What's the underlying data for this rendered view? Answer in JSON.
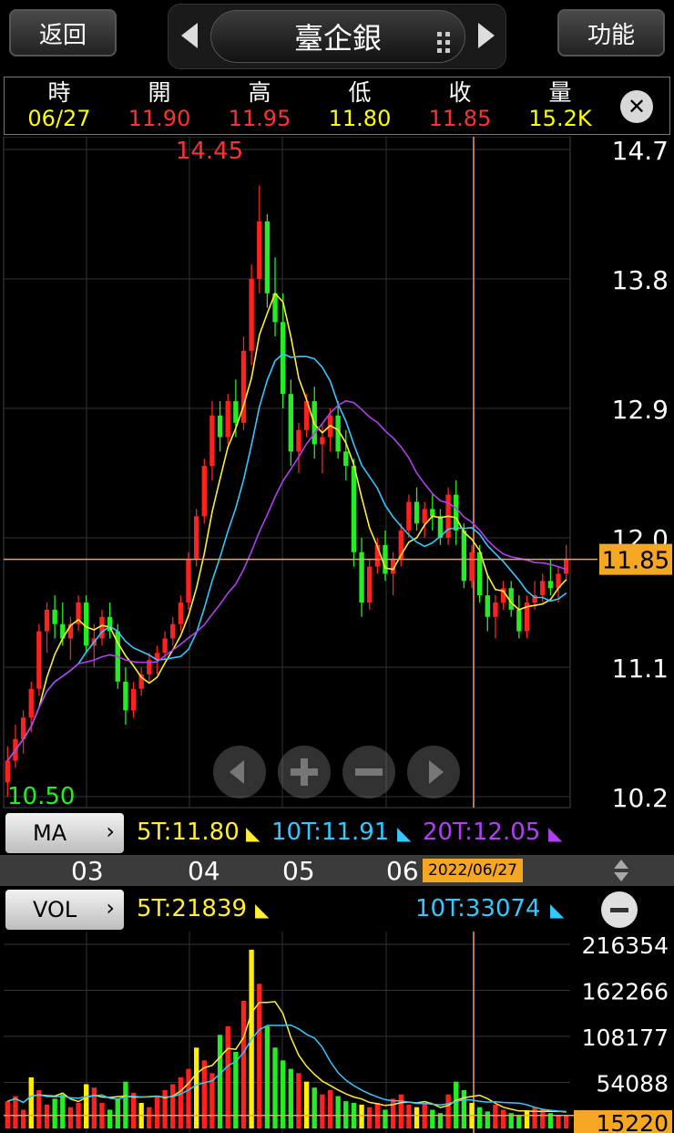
{
  "header": {
    "back_label": "返回",
    "title": "臺企銀",
    "function_label": "功能"
  },
  "quote": {
    "labels": [
      "時",
      "開",
      "高",
      "低",
      "收",
      "量"
    ],
    "values": [
      "06/27",
      "11.90",
      "11.95",
      "11.80",
      "11.85",
      "15.2K"
    ],
    "colors": [
      "#ffff00",
      "#ff3030",
      "#ff3030",
      "#ffff00",
      "#ff3030",
      "#ffff00"
    ]
  },
  "price_chart": {
    "max_label": "14.45",
    "min_label": "10.50",
    "y_ticks": [
      "14.7",
      "13.8",
      "12.9",
      "12.0",
      "11.1",
      "10.2"
    ],
    "current_price": "11.85",
    "current_price_value": 11.85,
    "ylim": [
      10.2,
      14.7
    ]
  },
  "ma_legend": {
    "button_label": "MA",
    "ma5": "5T:11.80",
    "ma10": "10T:11.91",
    "ma20": "20T:12.05",
    "colors": {
      "ma5": "#ffee33",
      "ma10": "#33c8ff",
      "ma20": "#b040f0"
    }
  },
  "timeline": {
    "months": [
      "03",
      "04",
      "05",
      "06"
    ],
    "selected_date": "2022/06/27"
  },
  "volume": {
    "button_label": "VOL",
    "ma5": "5T:21839",
    "ma10": "10T:33074",
    "y_ticks": [
      "216354",
      "162266",
      "108177",
      "54088"
    ],
    "current_volume": "15220",
    "current_volume_value": 15220,
    "ymax": 216354
  },
  "chart_data": {
    "type": "candlestick",
    "open_high_low_close": [
      [
        10.3,
        10.55,
        10.2,
        10.45
      ],
      [
        10.45,
        10.7,
        10.4,
        10.6
      ],
      [
        10.6,
        10.8,
        10.5,
        10.75
      ],
      [
        10.75,
        11.0,
        10.65,
        10.95
      ],
      [
        10.95,
        11.4,
        10.9,
        11.35
      ],
      [
        11.35,
        11.55,
        11.2,
        11.5
      ],
      [
        11.5,
        11.6,
        11.3,
        11.4
      ],
      [
        11.4,
        11.55,
        11.25,
        11.3
      ],
      [
        11.3,
        11.45,
        11.15,
        11.4
      ],
      [
        11.4,
        11.6,
        11.35,
        11.55
      ],
      [
        11.55,
        11.6,
        11.2,
        11.25
      ],
      [
        11.25,
        11.4,
        11.1,
        11.3
      ],
      [
        11.3,
        11.5,
        11.25,
        11.45
      ],
      [
        11.45,
        11.55,
        11.3,
        11.35
      ],
      [
        11.35,
        11.4,
        10.95,
        11.0
      ],
      [
        11.0,
        11.1,
        10.7,
        10.8
      ],
      [
        10.8,
        11.0,
        10.75,
        10.95
      ],
      [
        10.95,
        11.1,
        10.9,
        11.05
      ],
      [
        11.05,
        11.2,
        11.0,
        11.15
      ],
      [
        11.15,
        11.25,
        11.05,
        11.2
      ],
      [
        11.2,
        11.35,
        11.15,
        11.3
      ],
      [
        11.3,
        11.45,
        11.25,
        11.4
      ],
      [
        11.4,
        11.6,
        11.35,
        11.55
      ],
      [
        11.55,
        11.9,
        11.5,
        11.85
      ],
      [
        11.85,
        12.2,
        11.8,
        12.15
      ],
      [
        12.15,
        12.55,
        12.1,
        12.5
      ],
      [
        12.5,
        12.95,
        12.4,
        12.85
      ],
      [
        12.85,
        12.95,
        12.6,
        12.7
      ],
      [
        12.7,
        13.0,
        12.65,
        12.95
      ],
      [
        12.95,
        13.1,
        12.7,
        12.8
      ],
      [
        12.8,
        13.4,
        12.75,
        13.3
      ],
      [
        13.3,
        13.9,
        13.2,
        13.8
      ],
      [
        13.8,
        14.45,
        13.7,
        14.2
      ],
      [
        14.2,
        14.25,
        13.6,
        13.7
      ],
      [
        13.7,
        13.95,
        13.4,
        13.5
      ],
      [
        13.5,
        13.7,
        12.9,
        13.0
      ],
      [
        13.0,
        13.1,
        12.5,
        12.6
      ],
      [
        12.6,
        12.8,
        12.45,
        12.75
      ],
      [
        12.75,
        13.0,
        12.7,
        12.95
      ],
      [
        12.95,
        13.05,
        12.55,
        12.65
      ],
      [
        12.65,
        12.8,
        12.45,
        12.7
      ],
      [
        12.7,
        12.9,
        12.6,
        12.85
      ],
      [
        12.85,
        12.95,
        12.55,
        12.6
      ],
      [
        12.6,
        12.75,
        12.4,
        12.5
      ],
      [
        12.5,
        12.55,
        11.8,
        11.9
      ],
      [
        11.9,
        12.0,
        11.45,
        11.55
      ],
      [
        11.55,
        11.85,
        11.5,
        11.8
      ],
      [
        11.8,
        12.0,
        11.75,
        11.95
      ],
      [
        11.95,
        12.05,
        11.7,
        11.75
      ],
      [
        11.75,
        11.9,
        11.6,
        11.85
      ],
      [
        11.85,
        12.1,
        11.8,
        12.05
      ],
      [
        12.05,
        12.3,
        12.0,
        12.25
      ],
      [
        12.25,
        12.35,
        12.05,
        12.1
      ],
      [
        12.1,
        12.25,
        12.0,
        12.2
      ],
      [
        12.2,
        12.3,
        12.05,
        12.15
      ],
      [
        12.15,
        12.2,
        11.95,
        12.0
      ],
      [
        12.0,
        12.35,
        11.95,
        12.3
      ],
      [
        12.3,
        12.4,
        11.95,
        12.05
      ],
      [
        12.05,
        12.1,
        11.65,
        11.7
      ],
      [
        11.7,
        11.95,
        11.65,
        11.9
      ],
      [
        11.9,
        11.95,
        11.55,
        11.6
      ],
      [
        11.6,
        11.75,
        11.35,
        11.45
      ],
      [
        11.45,
        11.6,
        11.3,
        11.55
      ],
      [
        11.55,
        11.7,
        11.5,
        11.65
      ],
      [
        11.65,
        11.7,
        11.45,
        11.5
      ],
      [
        11.5,
        11.6,
        11.3,
        11.35
      ],
      [
        11.35,
        11.6,
        11.3,
        11.55
      ],
      [
        11.55,
        11.7,
        11.5,
        11.6
      ],
      [
        11.6,
        11.75,
        11.55,
        11.7
      ],
      [
        11.7,
        11.85,
        11.6,
        11.65
      ],
      [
        11.65,
        11.8,
        11.55,
        11.75
      ],
      [
        11.75,
        11.95,
        11.7,
        11.85
      ]
    ],
    "volumes": [
      32000,
      38000,
      22000,
      60000,
      45000,
      28000,
      35000,
      40000,
      25000,
      30000,
      52000,
      48000,
      30000,
      22000,
      35000,
      55000,
      42000,
      30000,
      25000,
      38000,
      45000,
      52000,
      60000,
      70000,
      95000,
      80000,
      65000,
      110000,
      120000,
      90000,
      150000,
      210000,
      170000,
      120000,
      95000,
      80000,
      70000,
      65000,
      55000,
      48000,
      40000,
      45000,
      38000,
      32000,
      30000,
      28000,
      25000,
      30000,
      22000,
      35000,
      40000,
      28000,
      25000,
      30000,
      22000,
      18000,
      40000,
      55000,
      45000,
      30000,
      25000,
      20000,
      28000,
      22000,
      18000,
      15000,
      20000,
      25000,
      22000,
      18000,
      16000,
      15220
    ]
  }
}
